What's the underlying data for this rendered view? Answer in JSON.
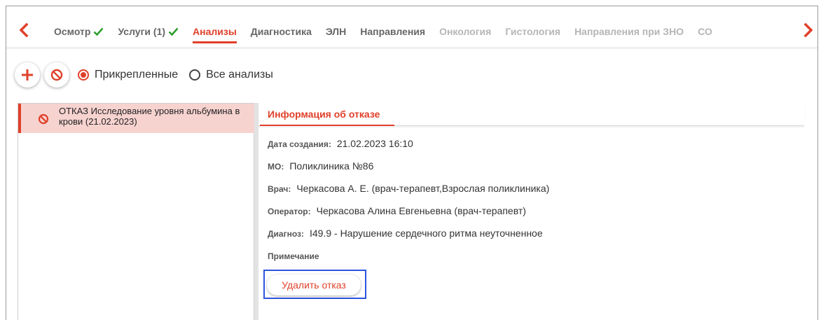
{
  "tabs": [
    {
      "label": "Осмотр",
      "checked": true,
      "state": "normal"
    },
    {
      "label": "Услуги (1)",
      "checked": true,
      "state": "normal"
    },
    {
      "label": "Анализы",
      "checked": false,
      "state": "active"
    },
    {
      "label": "Диагностика",
      "checked": false,
      "state": "normal"
    },
    {
      "label": "ЭЛН",
      "checked": false,
      "state": "normal"
    },
    {
      "label": "Направления",
      "checked": false,
      "state": "normal"
    },
    {
      "label": "Онкология",
      "checked": false,
      "state": "dim"
    },
    {
      "label": "Гистология",
      "checked": false,
      "state": "dim"
    },
    {
      "label": "Направления при ЗНО",
      "checked": false,
      "state": "dim"
    },
    {
      "label": "СО",
      "checked": false,
      "state": "dim"
    }
  ],
  "icons": {
    "prev": "chevron-left-icon",
    "next": "chevron-right-icon",
    "add": "plus-icon",
    "refuse": "ban-icon",
    "check": "checkmark-icon"
  },
  "colors": {
    "accent": "#e0402a",
    "check": "#2f9e2f",
    "highlight": "#2d55e0",
    "selected_bg": "#f7d3d0"
  },
  "filter": {
    "attached_label": "Прикрепленные",
    "all_label": "Все анализы",
    "selected": "attached"
  },
  "list": {
    "items": [
      {
        "text": "ОТКАЗ Исследование уровня альбумина в крови (21.02.2023)"
      }
    ]
  },
  "info": {
    "title": "Информация об отказе",
    "created_label": "Дата создания:",
    "created_value": "21.02.2023 16:10",
    "mo_label": "МО:",
    "mo_value": "Поликлиника №86",
    "doctor_label": "Врач:",
    "doctor_value": "Черкасова А. Е. (врач-терапевт,Взрослая поликлиника)",
    "operator_label": "Оператор:",
    "operator_value": "Черкасова Алина Евгеньевна (врач-терапевт)",
    "diagnosis_label": "Диагноз:",
    "diagnosis_value": "I49.9 - Нарушение сердечного ритма неуточненное",
    "note_label": "Примечание",
    "delete_button": "Удалить отказ"
  }
}
